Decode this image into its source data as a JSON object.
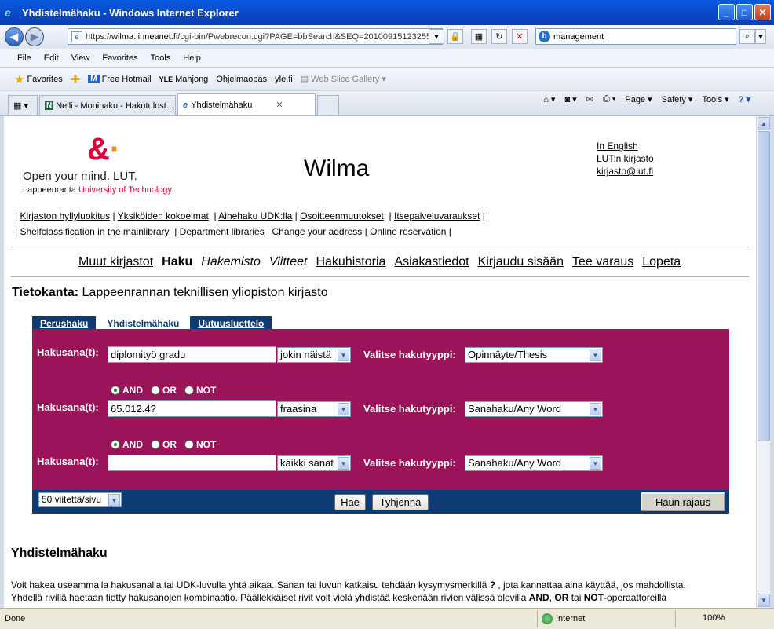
{
  "window": {
    "title": "Yhdistelmähaku - Windows Internet Explorer",
    "controls": {
      "minimize": "_",
      "maximize": "□",
      "close": "✕"
    }
  },
  "address": {
    "url_prefix": "https://",
    "url_domain": "wilma.linneanet.fi",
    "url_path": "/cgi-bin/Pwebrecon.cgi?PAGE=bbSearch&SEQ=20100915123255",
    "search_value": "management"
  },
  "menu": [
    "File",
    "Edit",
    "View",
    "Favorites",
    "Tools",
    "Help"
  ],
  "favorites": {
    "label": "Favorites",
    "items": [
      "Free Hotmail",
      "Mahjong",
      "Ohjelmaopas",
      "yle.fi",
      "Web Slice Gallery"
    ]
  },
  "tabs": [
    {
      "label": "Nelli - Monihaku - Hakutulost..."
    },
    {
      "label": "Yhdistelmähaku"
    }
  ],
  "commands": [
    "Page",
    "Safety",
    "Tools"
  ],
  "page": {
    "logo_slogan": "Open your mind. LUT.",
    "logo_uni_a": "Lappeenranta",
    "logo_uni_b": "University of Technology",
    "app_title": "Wilma",
    "top_links": [
      "In English",
      "LUT:n kirjasto",
      "kirjasto@lut.fi"
    ],
    "links_row1": [
      "Kirjaston  hyllyluokitus",
      "Yksiköiden kokoelmat",
      "Aihehaku  UDK:lla",
      "Osoitteenmuutokset",
      "Itsepalveluvaraukset"
    ],
    "links_row2": [
      " Shelfclassification in the mainlibrary",
      "Department libraries",
      "Change your address",
      "Online reservation"
    ],
    "main_nav": [
      "Muut kirjastot",
      "Haku",
      "Hakemisto",
      "Viitteet",
      "Hakuhistoria",
      "Asiakastiedot",
      "Kirjaudu sisään",
      "Tee varaus",
      "Lopeta"
    ],
    "db_label": "Tietokanta:",
    "db_value": "Lappeenrannan teknillisen yliopiston kirjasto",
    "search_tabs": [
      "Perushaku",
      "Yhdistelmähaku",
      "Uutuusluettelo"
    ],
    "term_label": "Hakusana(t):",
    "type_label": "Valitse hakutyyppi:",
    "rows": [
      {
        "term": "diplomityö gradu",
        "mode": "jokin näistä",
        "type": "Opinnäyte/Thesis"
      },
      {
        "term": "65.012.4?",
        "mode": "fraasina",
        "type": "Sanahaku/Any Word"
      },
      {
        "term": "",
        "mode": "kaikki sanat",
        "type": "Sanahaku/Any Word"
      }
    ],
    "bool": {
      "and": "AND",
      "or": "OR",
      "not": "NOT"
    },
    "per_page": "50 viitettä/sivu",
    "buttons": {
      "search": "Hae",
      "clear": "Tyhjennä",
      "limit": "Haun rajaus"
    },
    "section_title": "Yhdistelmähaku",
    "para_1a": "Voit hakea useammalla hakusanalla tai UDK-luvulla yhtä aikaa. Sanan tai luvun katkaisu tehdään kysymysmerkillä ",
    "para_1q": "?",
    "para_1b": " , jota kannattaa aina käyttää, jos mahdollista.",
    "para_2a": "Yhdellä rivillä haetaan tietty hakusanojen kombinaatio. Päällekkäiset rivit voit vielä yhdistää keskenään rivien välissä olevilla ",
    "para_2and": "AND",
    "para_2c": ", ",
    "para_2or": "OR",
    "para_2d": " tai ",
    "para_2not": "NOT",
    "para_2e": "-operaattoreilla"
  },
  "status": {
    "left": "Done",
    "zone": "Internet",
    "zoom": "100%"
  }
}
